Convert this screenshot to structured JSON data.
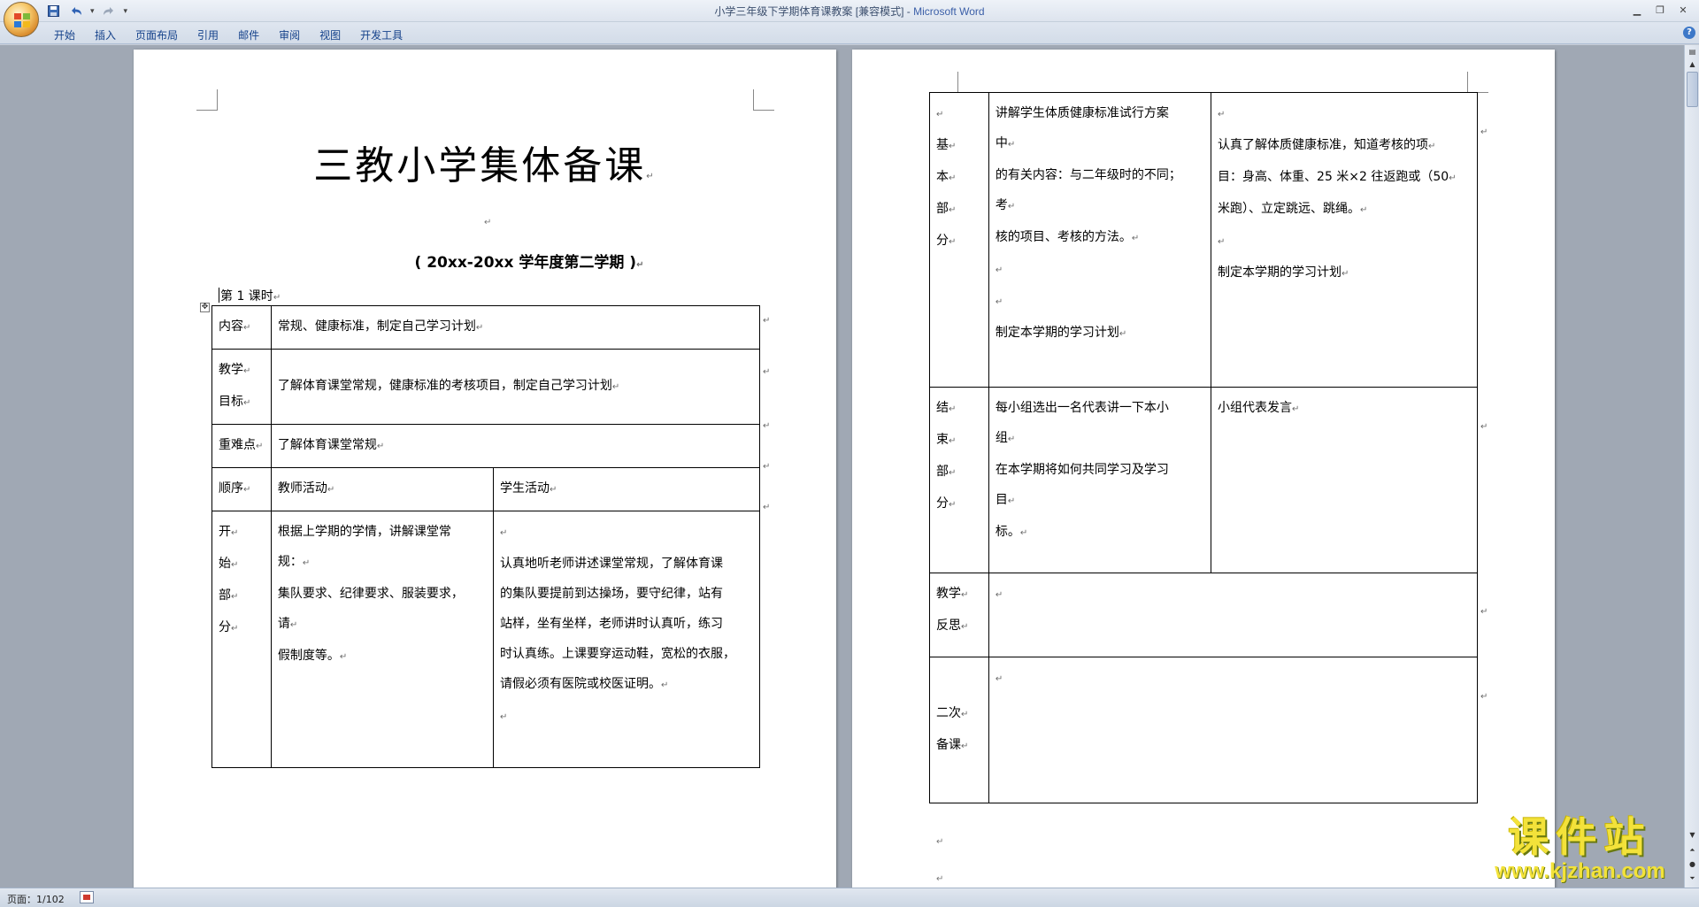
{
  "window": {
    "title_doc": "小学三年级下学期体育课教案 [兼容模式]",
    "title_sep": " - ",
    "title_app": "Microsoft Word"
  },
  "quick_access": {
    "icons": [
      "save-icon",
      "undo-icon",
      "redo-icon",
      "customize-icon"
    ]
  },
  "ribbon": {
    "tabs": [
      "开始",
      "插入",
      "页面布局",
      "引用",
      "邮件",
      "审阅",
      "视图",
      "开发工具"
    ]
  },
  "document": {
    "title": "三教小学集体备课",
    "subtitle": "( 20xx-20xx 学年度第二学期 )",
    "lesson": "第 1 课时",
    "page1_table": {
      "content_label": "内容",
      "content_value": "常规、健康标准，制定自己学习计划",
      "goal_label_1": "教学",
      "goal_label_2": "目标",
      "goal_value": "了解体育课堂常规，健康标准的考核项目，制定自己学习计划",
      "key_label": "重难点",
      "key_value": "了解体育课堂常规",
      "order_label": "顺序",
      "teacher_header": "教师活动",
      "student_header": "学生活动",
      "start_label": [
        "开",
        "始",
        "部",
        "分"
      ],
      "start_teacher": [
        "根据上学期的学情，讲解课堂常",
        "规：",
        "集队要求、纪律要求、服装要求，",
        "请",
        "假制度等。"
      ],
      "start_student": [
        "",
        "认真地听老师讲述课堂常规，了解体育课",
        "的集队要提前到达操场，要守纪律，站有",
        "站样，坐有坐样，老师讲时认真听，练习",
        "时认真练。上课要穿运动鞋，宽松的衣服，",
        "请假必须有医院或校医证明。",
        ""
      ]
    },
    "page2_table": {
      "basic_label": [
        "基",
        "本",
        "部",
        "分"
      ],
      "basic_teacher": [
        "讲解学生体质健康标准试行方案",
        "中",
        "的有关内容：与二年级时的不同；",
        "考",
        "核的项目、考核的方法。",
        "",
        "",
        "制定本学期的学习计划"
      ],
      "basic_student": [
        "",
        "认真了解体质健康标准，知道考核的项",
        "目：身高、体重、25 米×2 往返跑或（50",
        "米跑）、立定跳远、跳绳。",
        "",
        "制定本学期的学习计划"
      ],
      "end_label": [
        "结",
        "束",
        "部",
        "分"
      ],
      "end_teacher": [
        "每小组选出一名代表讲一下本小",
        "组",
        "在本学期将如何共同学习及学习",
        "目",
        "标。"
      ],
      "end_student": [
        "小组代表发言"
      ],
      "reflect_label_1": "教学",
      "reflect_label_2": "反思",
      "second_label_1": "二次",
      "second_label_2": "备课"
    }
  },
  "status": {
    "page_info": "页面：1/102"
  },
  "watermark": {
    "cn": "课件站",
    "url": "www.kjzhan.com"
  }
}
